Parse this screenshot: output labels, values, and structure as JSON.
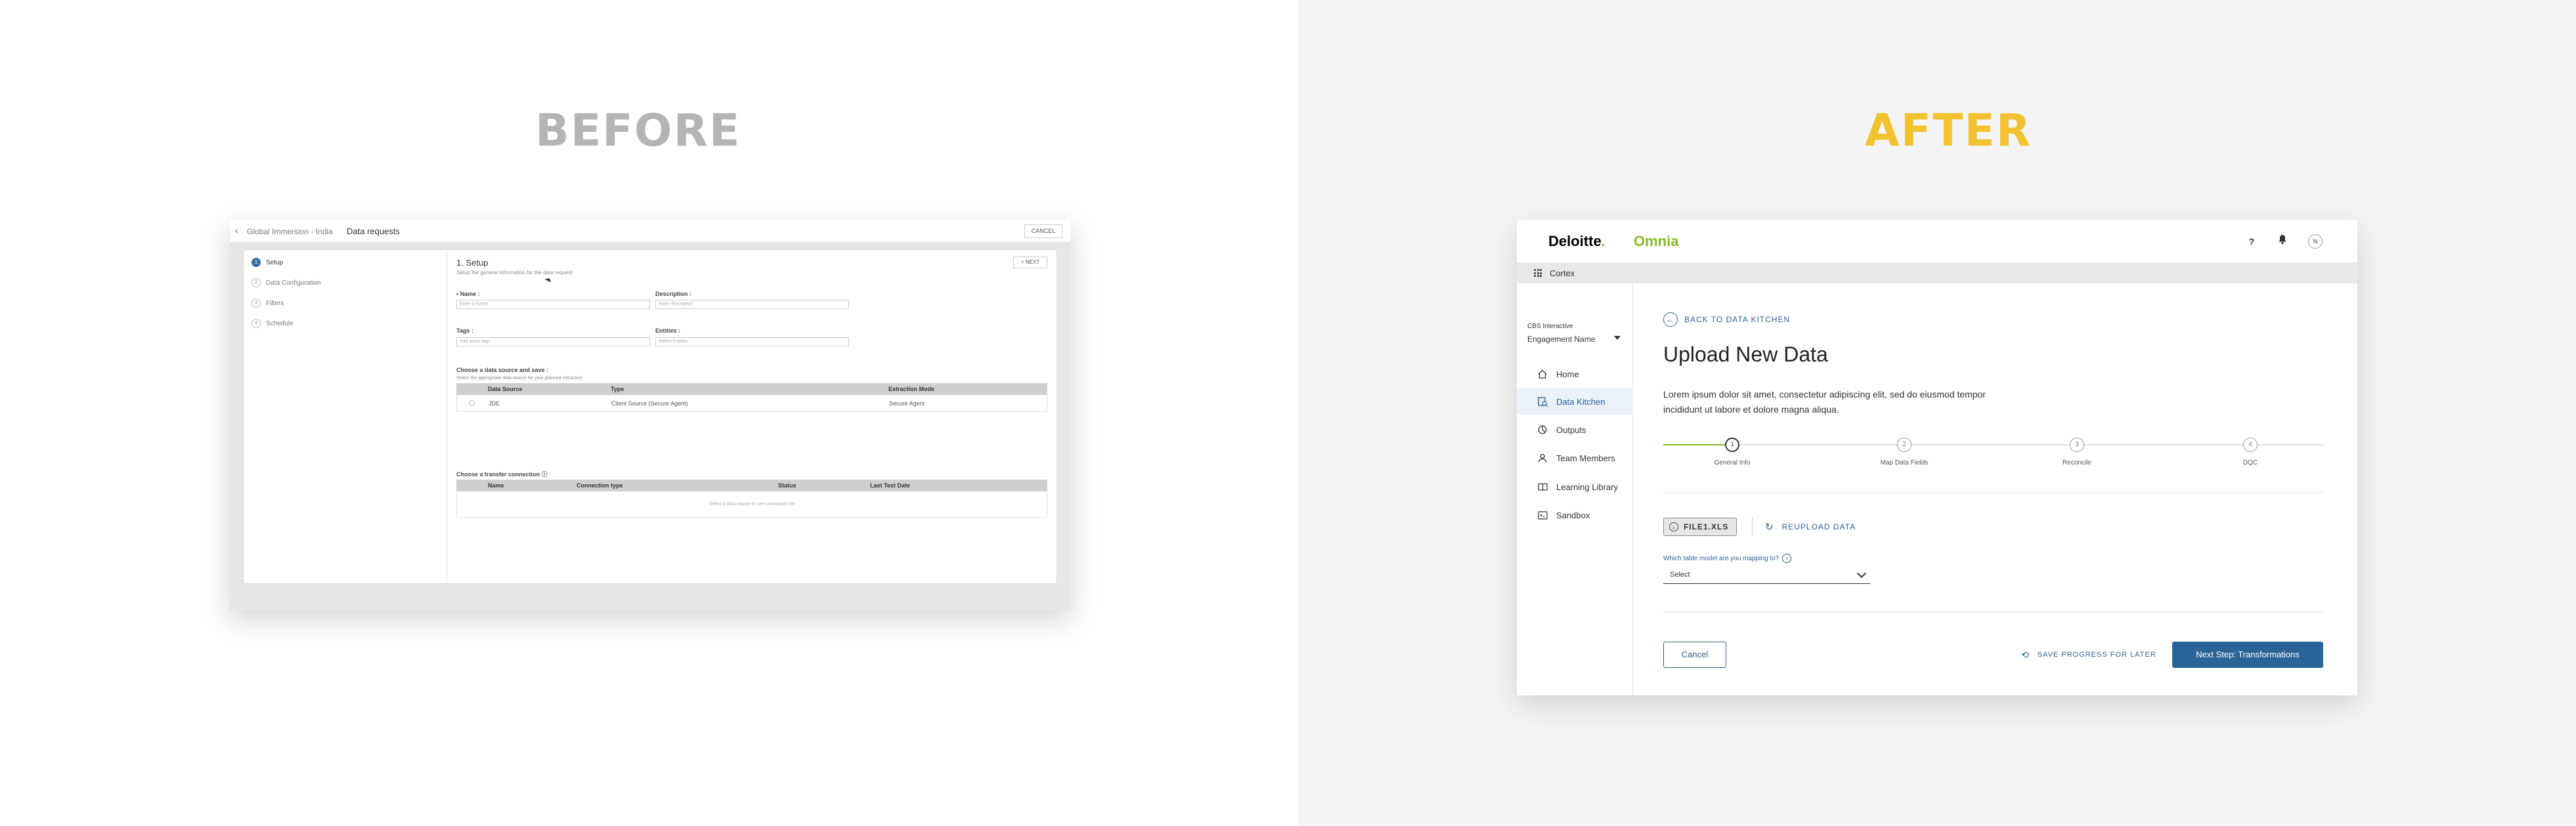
{
  "titles": {
    "before": "BEFORE",
    "after": "AFTER"
  },
  "before": {
    "header": {
      "back_icon": "chevron-left-icon",
      "breadcrumb": "Global Immersion - India",
      "page": "Data requests",
      "cancel": "CANCEL"
    },
    "steps": [
      {
        "num": "1",
        "label": "Setup"
      },
      {
        "num": "2",
        "label": "Data Configuration"
      },
      {
        "num": "3",
        "label": "Filters"
      },
      {
        "num": "4",
        "label": "Schedule"
      }
    ],
    "main": {
      "heading": "1. Setup",
      "subheading": "Setup the general information for the data request",
      "next": "> NEXT",
      "fields": {
        "name_label": "• Name :",
        "name_placeholder": "Enter a Name",
        "description_label": "Description :",
        "description_placeholder": "Enter description",
        "tags_label": "Tags :",
        "tags_placeholder": "Add some tags",
        "entities_label": "Entities :",
        "entities_placeholder": "Select Entities"
      },
      "source_section": {
        "title": "Choose a data source and save :",
        "subtitle": "Select the appropriate data source for your planned extraction",
        "columns": [
          "Data Source",
          "Type",
          "Extraction Mode"
        ],
        "rows": [
          {
            "source": "JDE",
            "type": "Client Source (Secure Agent)",
            "mode": "Secure Agent"
          }
        ]
      },
      "transfer_section": {
        "title": "Choose a transfer connection ⓘ",
        "columns": [
          "Name",
          "Connection type",
          "Status",
          "Last Test Date"
        ],
        "empty": "Select a data source to see connection list"
      }
    }
  },
  "after": {
    "brand": {
      "deloitte": "Deloitte",
      "dot": ".",
      "omnia": "Omnia"
    },
    "top_icons": {
      "help": "?",
      "bell_icon": "bell-icon",
      "avatar": "N"
    },
    "bar": {
      "app": "Cortex"
    },
    "sidebar": {
      "client": "CBS Interactive",
      "engagement": "Engagement Name",
      "items": [
        {
          "label": "Home",
          "icon": "home-icon"
        },
        {
          "label": "Data Kitchen",
          "icon": "data-kitchen-icon"
        },
        {
          "label": "Outputs",
          "icon": "outputs-icon"
        },
        {
          "label": "Team Members",
          "icon": "team-icon"
        },
        {
          "label": "Learning Library",
          "icon": "book-icon"
        },
        {
          "label": "Sandbox",
          "icon": "sandbox-icon"
        }
      ],
      "active_index": 1
    },
    "main": {
      "back": "BACK TO DATA KITCHEN",
      "title": "Upload New Data",
      "description": "Lorem ipsum dolor sit amet, consectetur adipiscing elit, sed do eiusmod tempor incididunt ut labore et dolore magna aliqua.",
      "stepper": {
        "progress": 0.1,
        "steps": [
          {
            "num": "1",
            "label": "General Info"
          },
          {
            "num": "2",
            "label": "Map Data Fields"
          },
          {
            "num": "3",
            "label": "Reconcile"
          },
          {
            "num": "4",
            "label": "DQC"
          }
        ]
      },
      "file": "FILE1.XLS",
      "reupload": "REUPLOAD DATA",
      "question": "Which table model are you mapping to?",
      "select_value": "Select",
      "cancel": "Cancel",
      "save": "SAVE PROGRESS FOR LATER",
      "next": "Next Step: Transformations"
    }
  }
}
